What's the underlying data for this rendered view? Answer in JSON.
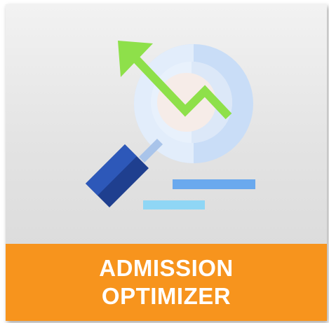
{
  "tile": {
    "icon": "magnifier-trend-up-icon",
    "title_line1": "ADMISSION",
    "title_line2": "OPTIMIZER"
  },
  "colors": {
    "banner": "#f7941d",
    "title_text": "#ffffff",
    "handle_dark": "#1f3f8f",
    "handle_light": "#2b56b8",
    "lens_ring": "#c7dcf6",
    "lens_inner": "#e3eefb",
    "arrow": "#8ee04a",
    "bar_top": "#6aa9ee",
    "bar_bottom": "#8fd6f5"
  }
}
